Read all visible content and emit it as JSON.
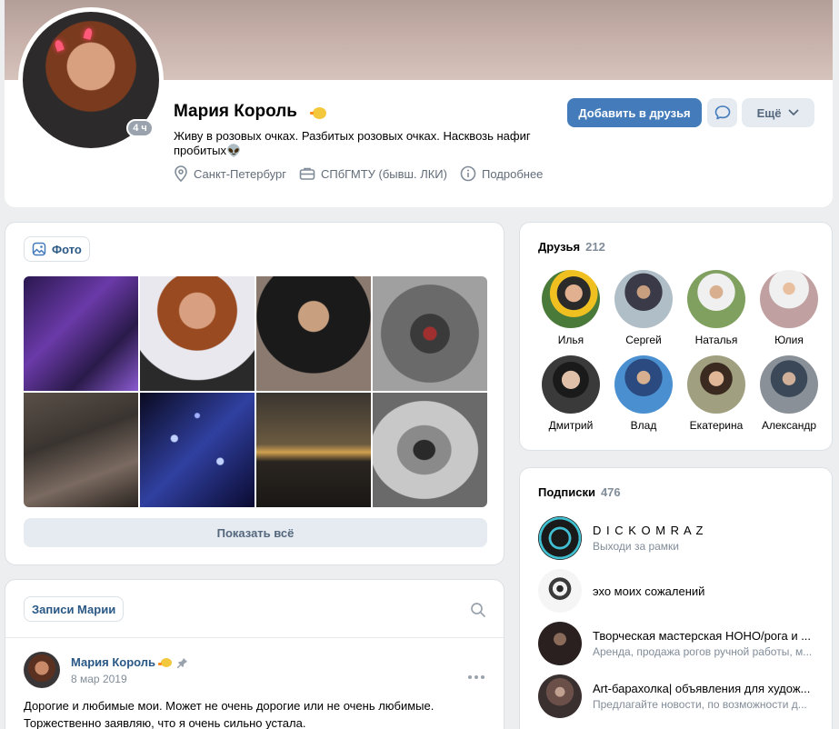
{
  "profile": {
    "name": "Мария Король",
    "status": "Живу в розовых очках. Разбитых розовых очках. Насквозь нафиг пробитых👽",
    "last_seen_badge": "4 ч",
    "city": "Санкт-Петербург",
    "university": "СПбГМТУ (бывш. ЛКИ)",
    "more_info": "Подробнее",
    "name_emoji": "chick-emoji"
  },
  "actions": {
    "add_friend": "Добавить в друзья",
    "message_icon": "message-icon",
    "more": "Ещё"
  },
  "photos": {
    "label": "Фото",
    "show_all": "Показать всё"
  },
  "wall": {
    "label": "Записи Марии",
    "post": {
      "author": "Мария Король",
      "date": "8 мар 2019",
      "text": "Дорогие и любимые мои. Может не очень дорогие или не очень любимые. Торжественно заявляю, что я очень сильно устала."
    }
  },
  "friends": {
    "title": "Друзья",
    "count": "212",
    "items": [
      {
        "name": "Илья",
        "color": "#5a8a3a"
      },
      {
        "name": "Сергей",
        "color": "#8aa0b0"
      },
      {
        "name": "Наталья",
        "color": "#7fa060"
      },
      {
        "name": "Юлия",
        "color": "#b08a8a"
      },
      {
        "name": "Дмитрий",
        "color": "#2a2a2a"
      },
      {
        "name": "Влад",
        "color": "#3a78b8"
      },
      {
        "name": "Екатерина",
        "color": "#9a9070"
      },
      {
        "name": "Александр",
        "color": "#7a8088"
      }
    ]
  },
  "subscriptions": {
    "title": "Подписки",
    "count": "476",
    "items": [
      {
        "name": "D I C K O M R A Z",
        "desc": "Выходи за рамки",
        "color": "#1a1a1a"
      },
      {
        "name": "эхо моих сожалений",
        "desc": "",
        "color": "#e8e8e8"
      },
      {
        "name": "Творческая мастерская НОНО/рога и ...",
        "desc": "Аренда, продажа рогов ручной работы, м...",
        "color": "#3a3030"
      },
      {
        "name": "Art-барахолка| объявления для худож...",
        "desc": "Предлагайте новости, по возможности д...",
        "color": "#5a4a48"
      }
    ]
  },
  "colors": {
    "accent": "#447bba",
    "link": "#2a5885",
    "muted": "#818c99"
  }
}
